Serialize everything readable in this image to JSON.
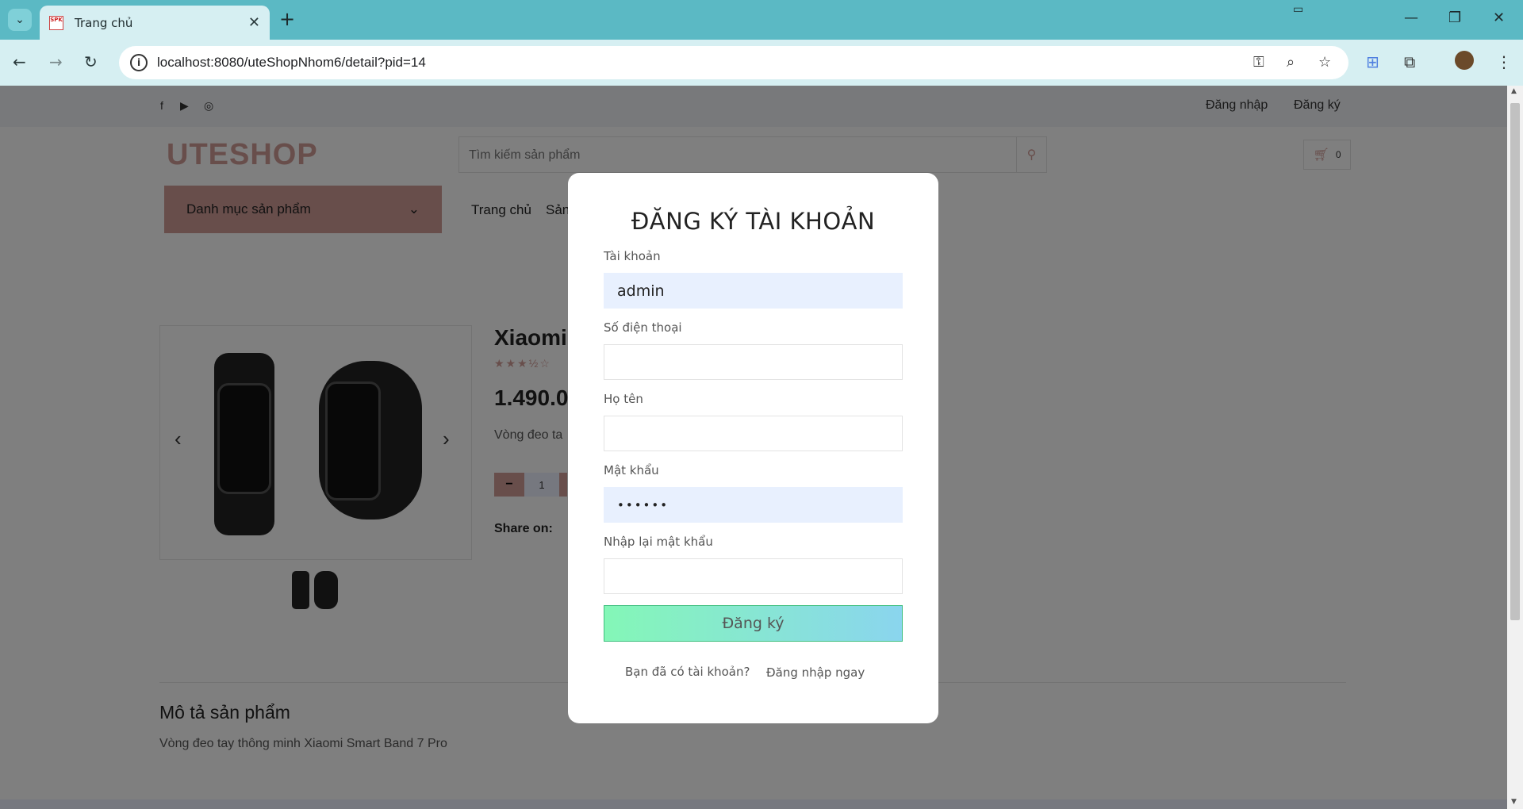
{
  "browser": {
    "tab_title": "Trang chủ",
    "favicon_text": "SPK",
    "url": "localhost:8080/uteShopNhom6/detail?pid=14"
  },
  "site": {
    "top_links": {
      "login": "Đăng nhập",
      "register": "Đăng ký"
    },
    "logo": "UTESHOP",
    "search_placeholder": "Tìm kiếm sản phẩm",
    "cart_count": "0",
    "category_button": "Danh mục sản phẩm",
    "menu": [
      "Trang chủ",
      "Sản"
    ]
  },
  "product": {
    "title": "Xiaomi",
    "rating_stars": "★★★½☆",
    "price": "1.490.0",
    "short_desc": "Vòng đeo ta",
    "quantity": "1",
    "share_label": "Share on:",
    "description_heading": "Mô tả sản phẩm",
    "description_text": "Vòng đeo tay thông minh Xiaomi Smart Band 7 Pro"
  },
  "modal": {
    "title": "ĐĂNG KÝ TÀI KHOẢN",
    "fields": [
      {
        "label": "Tài khoản",
        "value": ""
      },
      {
        "label": "Số điện thoại",
        "value": ""
      },
      {
        "label": "Họ tên",
        "value": ""
      },
      {
        "label": "Mật khẩu",
        "value": "••••••"
      },
      {
        "label": "Nhập lại mật khẩu",
        "value": ""
      }
    ],
    "username_value": "admin",
    "submit_label": "Đăng ký",
    "have_account_text": "Bạn đã có tài khoản?",
    "login_now_link": "Đăng nhập ngay"
  },
  "colors": {
    "brand": "#d19c97",
    "tabbar": "#5bb9c4",
    "autofill": "#e8f0fe"
  }
}
